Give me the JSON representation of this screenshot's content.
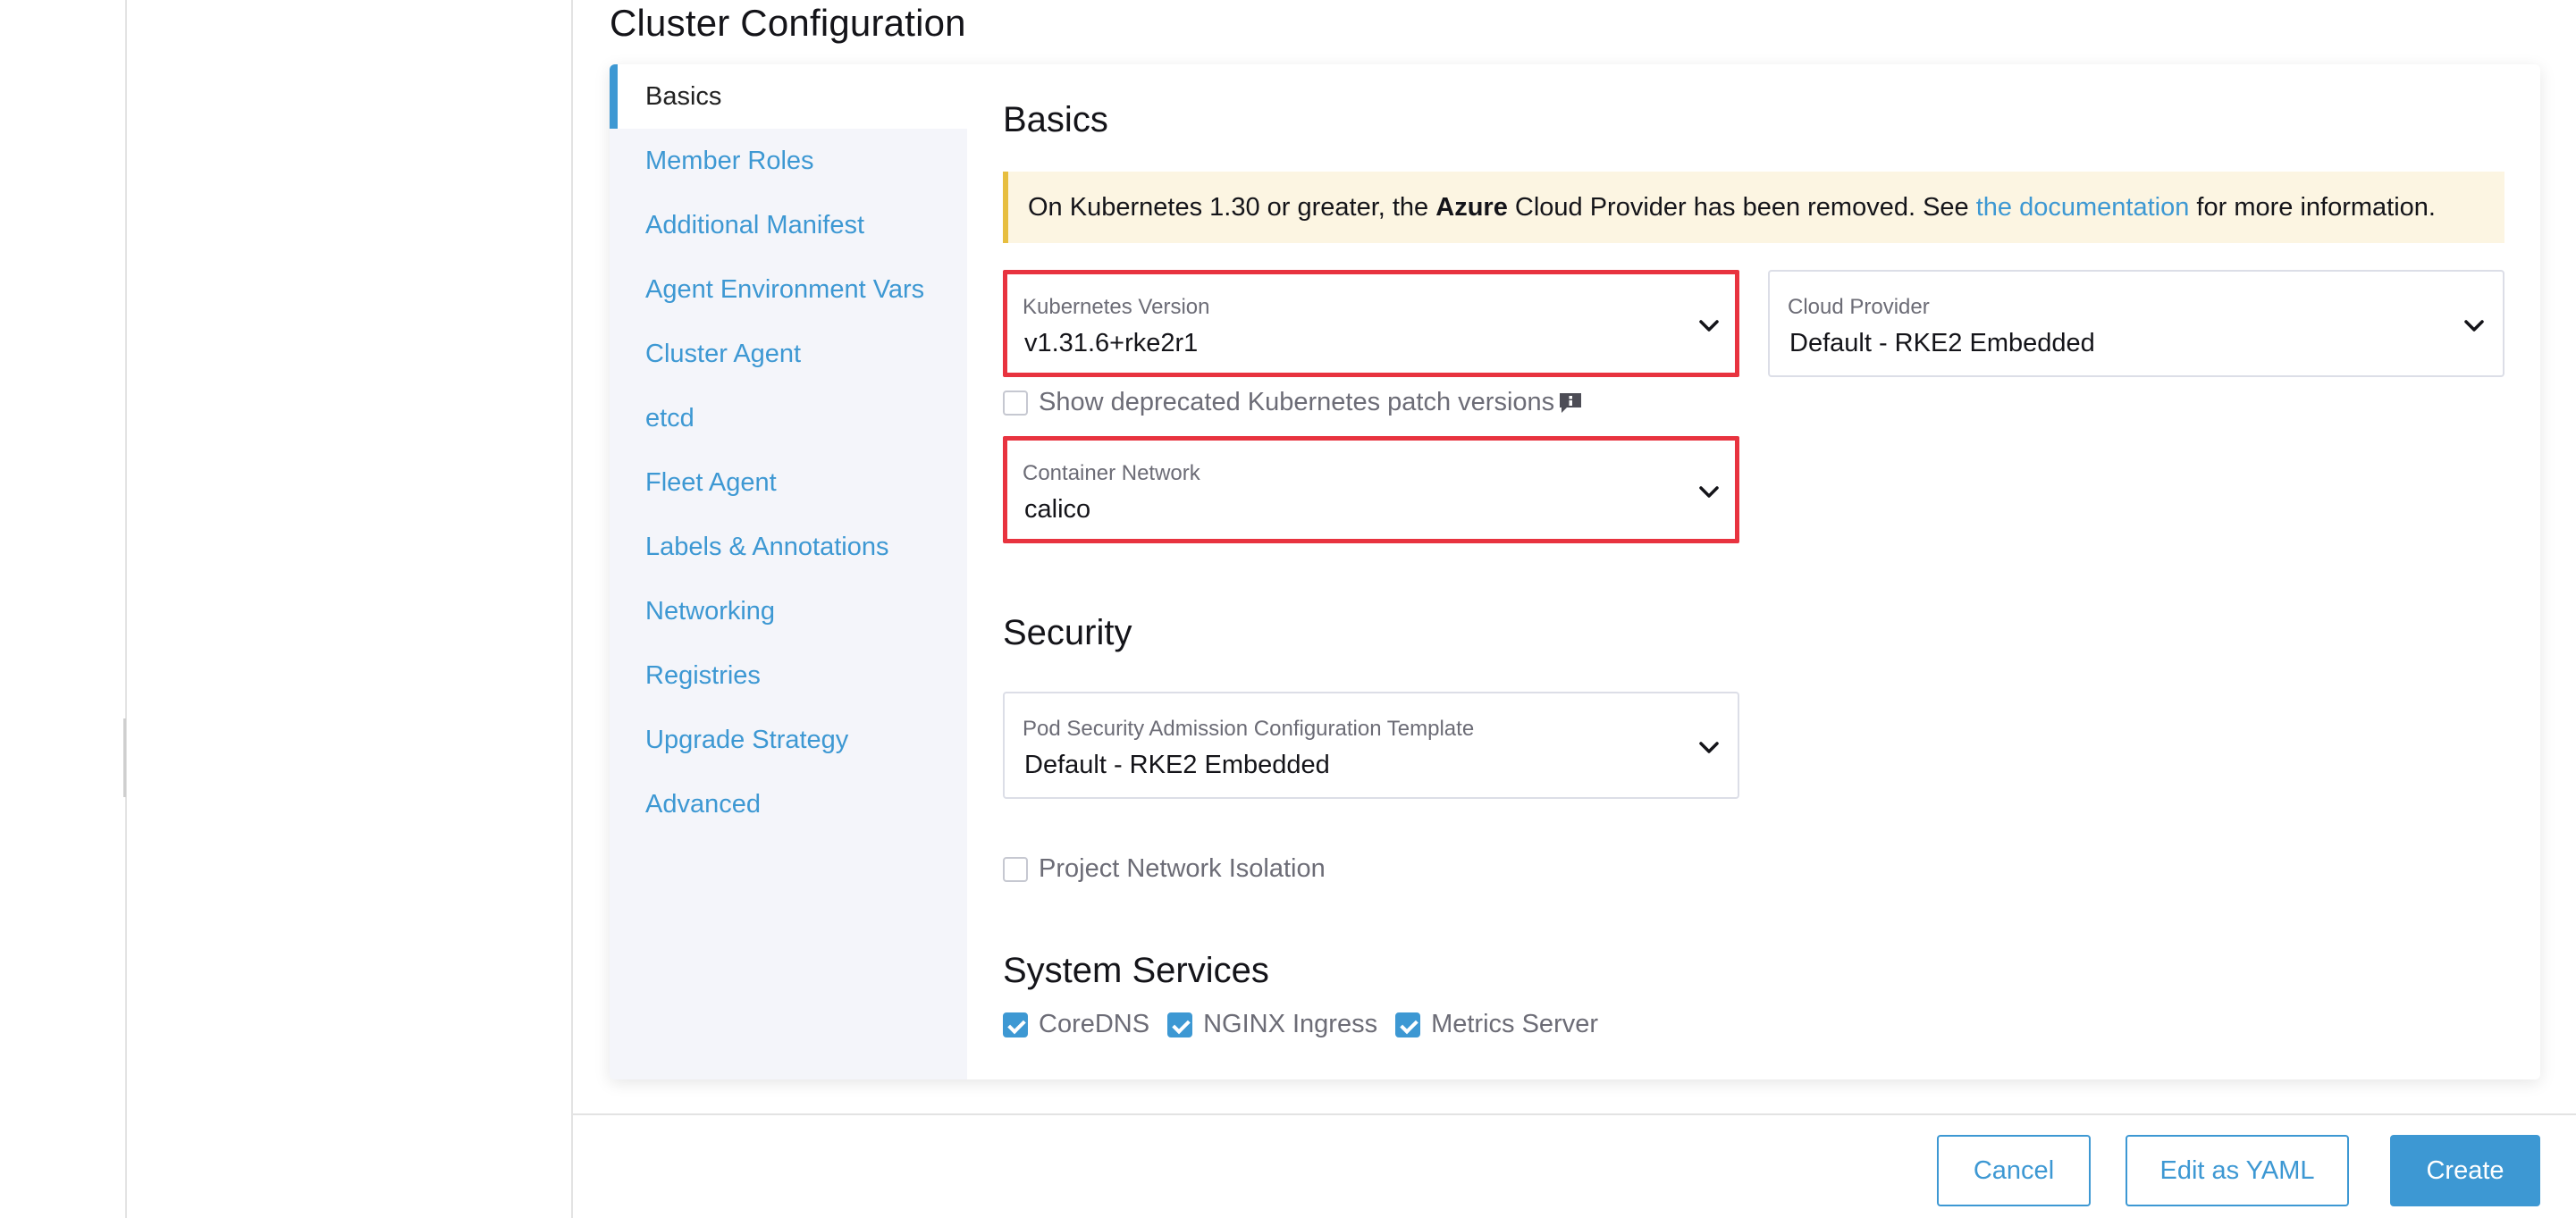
{
  "page_title": "Cluster Configuration",
  "side_tabs": [
    {
      "label": "Basics",
      "active": true
    },
    {
      "label": "Member Roles"
    },
    {
      "label": "Additional Manifest"
    },
    {
      "label": "Agent Environment Vars"
    },
    {
      "label": "Cluster Agent"
    },
    {
      "label": "etcd"
    },
    {
      "label": "Fleet Agent"
    },
    {
      "label": "Labels & Annotations"
    },
    {
      "label": "Networking"
    },
    {
      "label": "Registries"
    },
    {
      "label": "Upgrade Strategy"
    },
    {
      "label": "Advanced"
    }
  ],
  "basics": {
    "title": "Basics",
    "banner": {
      "text_before": "On Kubernetes 1.30 or greater, the ",
      "bold": "Azure",
      "text_middle": " Cloud Provider has been removed. See ",
      "link": "the documentation",
      "text_after": " for more information."
    },
    "kubernetes_version": {
      "label": "Kubernetes Version",
      "value": "v1.31.6+rke2r1"
    },
    "cloud_provider": {
      "label": "Cloud Provider",
      "value": "Default - RKE2 Embedded"
    },
    "show_deprecated": {
      "label": "Show deprecated Kubernetes patch versions",
      "checked": false
    },
    "container_network": {
      "label": "Container Network",
      "value": "calico"
    }
  },
  "security": {
    "title": "Security",
    "psa_template": {
      "label": "Pod Security Admission Configuration Template",
      "value": "Default - RKE2 Embedded"
    },
    "project_network_isolation": {
      "label": "Project Network Isolation",
      "checked": false
    }
  },
  "system_services": {
    "title": "System Services",
    "items": [
      {
        "label": "CoreDNS",
        "checked": true
      },
      {
        "label": "NGINX Ingress",
        "checked": true
      },
      {
        "label": "Metrics Server",
        "checked": true
      }
    ]
  },
  "footer": {
    "cancel": "Cancel",
    "edit_yaml": "Edit as YAML",
    "create": "Create"
  },
  "colors": {
    "accent": "#3d98d3",
    "highlight_border": "#e8333f",
    "banner_bg": "#fcf5e2",
    "banner_border": "#e7be3f"
  }
}
